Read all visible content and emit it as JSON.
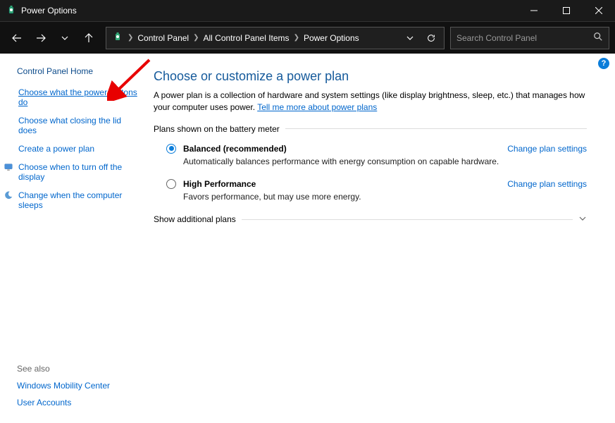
{
  "titlebar": {
    "title": "Power Options"
  },
  "searchbox": {
    "placeholder": "Search Control Panel"
  },
  "breadcrumbs": {
    "items": [
      "Control Panel",
      "All Control Panel Items",
      "Power Options"
    ]
  },
  "sidebar": {
    "home": "Control Panel Home",
    "tasks": [
      {
        "label": "Choose what the power buttons do",
        "icon": "",
        "highlight": true
      },
      {
        "label": "Choose what closing the lid does",
        "icon": ""
      },
      {
        "label": "Create a power plan",
        "icon": ""
      },
      {
        "label": "Choose when to turn off the display",
        "icon": "display-icon"
      },
      {
        "label": "Change when the computer sleeps",
        "icon": "moon-icon"
      }
    ],
    "seealso_header": "See also",
    "seealso": [
      "Windows Mobility Center",
      "User Accounts"
    ]
  },
  "main": {
    "heading": "Choose or customize a power plan",
    "desc_prefix": "A power plan is a collection of hardware and system settings (like display brightness, sleep, etc.) that manages how your computer uses power. ",
    "desc_link": "Tell me more about power plans",
    "section1": "Plans shown on the battery meter",
    "plans": [
      {
        "name": "Balanced (recommended)",
        "desc": "Automatically balances performance with energy consumption on capable hardware.",
        "checked": true,
        "link": "Change plan settings"
      },
      {
        "name": "High Performance",
        "desc": "Favors performance, but may use more energy.",
        "checked": false,
        "link": "Change plan settings"
      }
    ],
    "section2": "Show additional plans"
  }
}
